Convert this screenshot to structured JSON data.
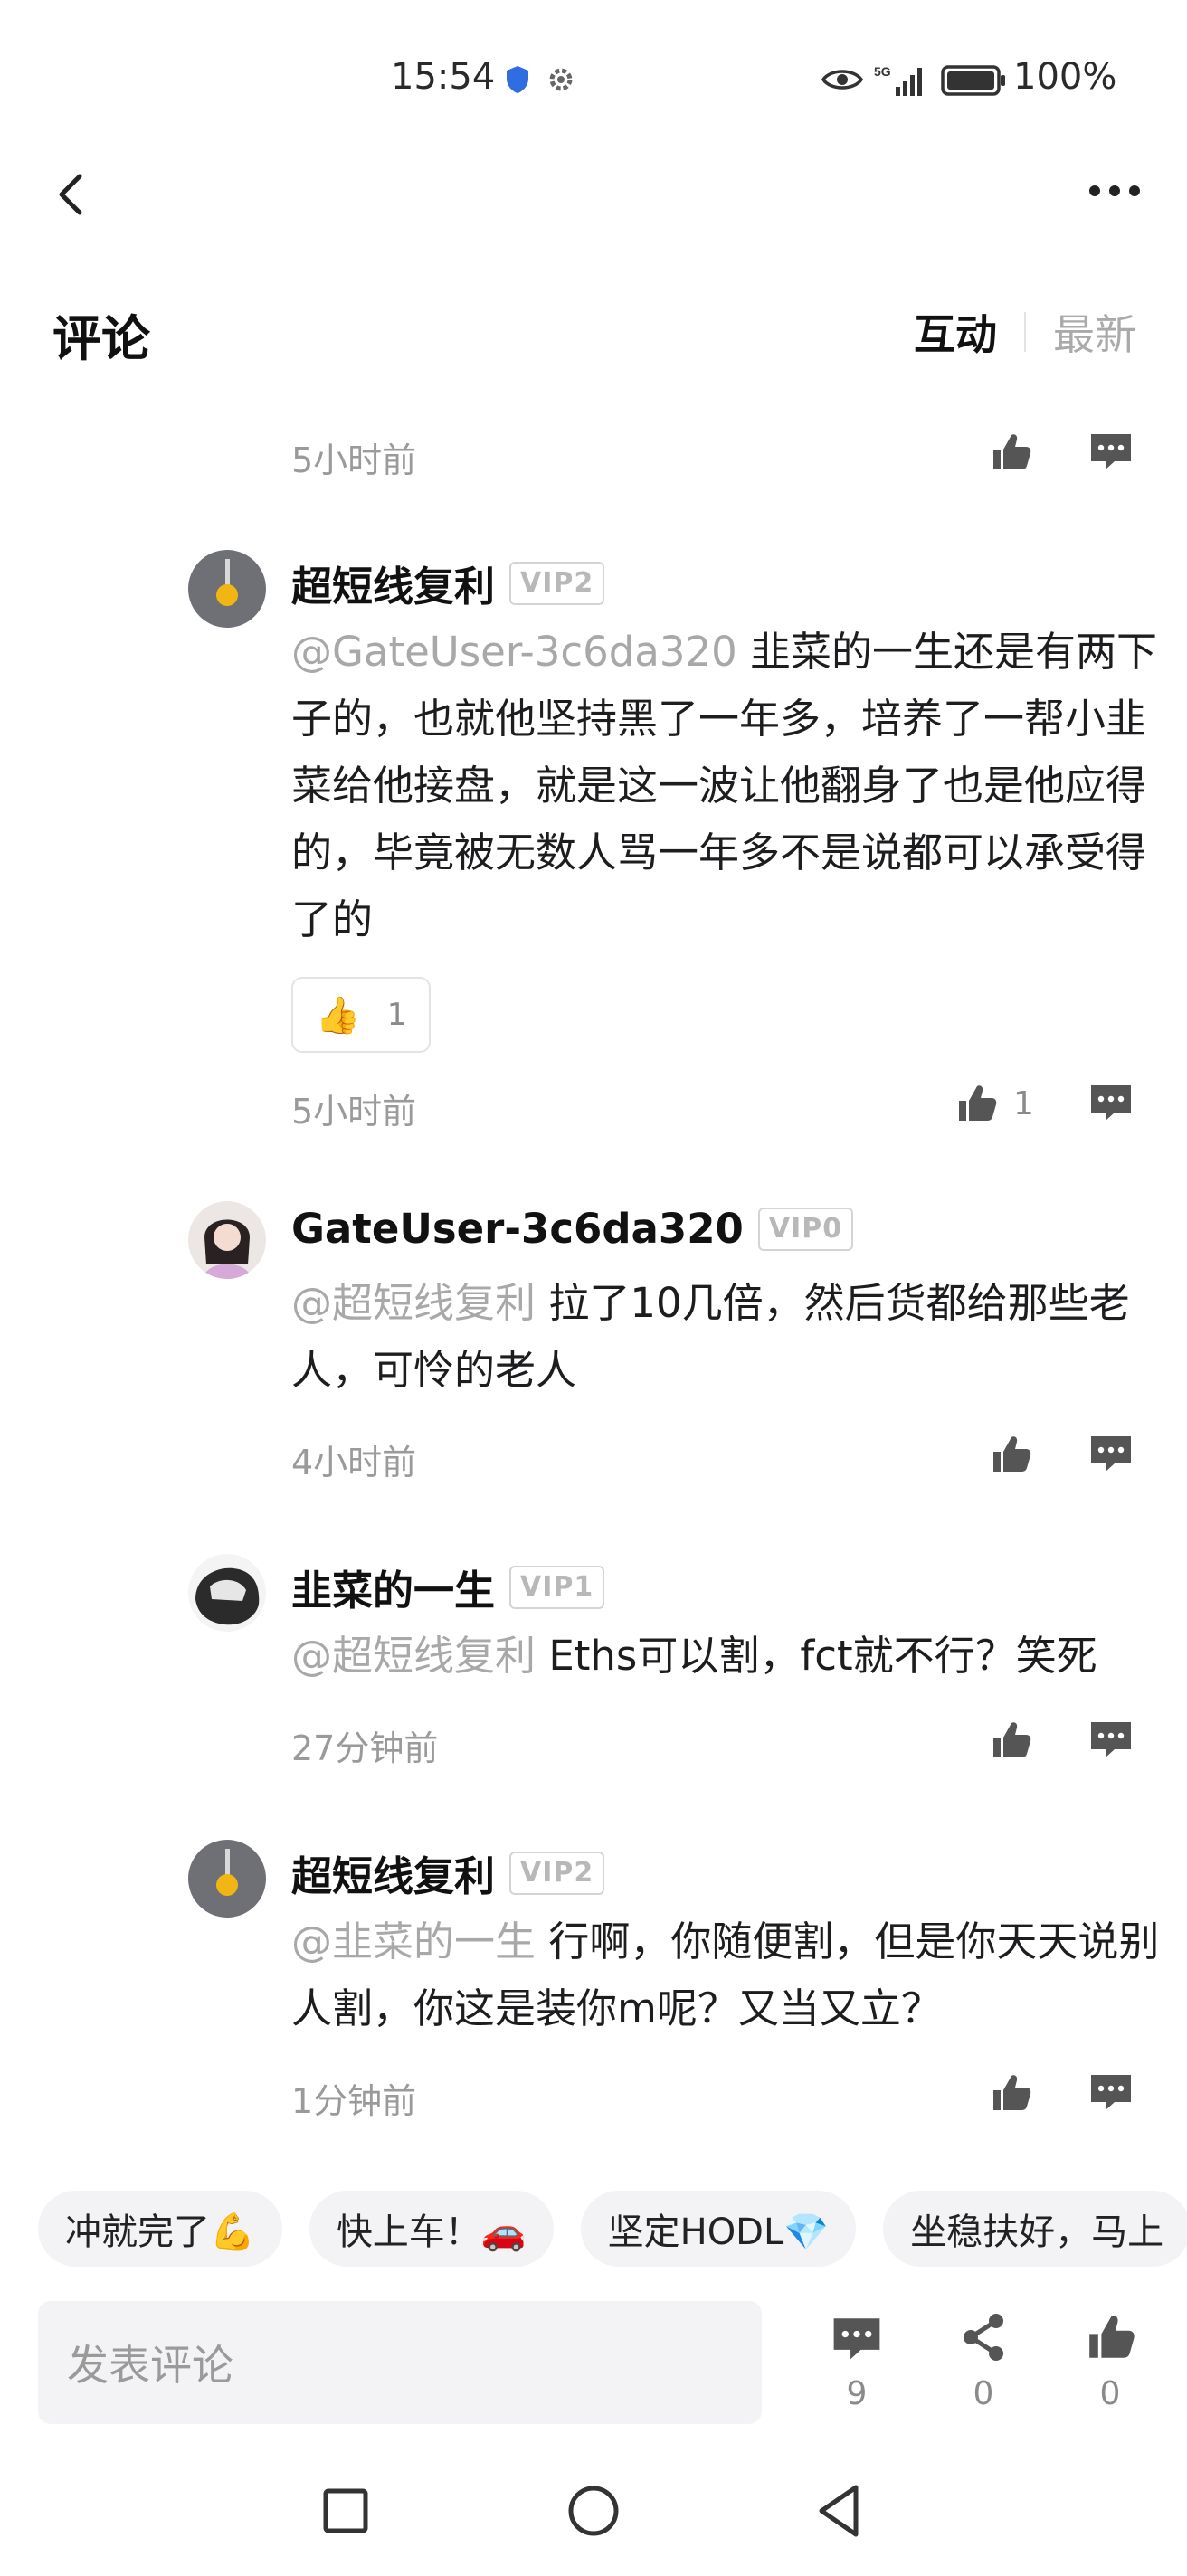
{
  "status_bar": {
    "time": "15:54",
    "network": "5G",
    "battery": "100%"
  },
  "header": {
    "title": "评论",
    "tabs": [
      {
        "label": "互动",
        "active": true
      },
      {
        "label": "最新",
        "active": false
      }
    ]
  },
  "top_partial": {
    "time": "5小时前"
  },
  "comments": [
    {
      "username": "超短线复利",
      "vip": "VIP2",
      "mention": "@GateUser-3c6da320",
      "text": " 韭菜的一生还是有两下子的，也就他坚持黑了一年多，培养了一帮小韭菜给他接盘，就是这一波让他翻身了也是他应得的，毕竟被无数人骂一年多不是说都可以承受得了的",
      "reaction": {
        "emoji": "👍",
        "count": "1"
      },
      "time": "5小时前",
      "likes": "1"
    },
    {
      "username": "GateUser-3c6da320",
      "vip": "VIP0",
      "mention": "@超短线复利",
      "text": " 拉了10几倍，然后货都给那些老人，可怜的老人",
      "time": "4小时前",
      "likes": ""
    },
    {
      "username": "韭菜的一生",
      "vip": "VIP1",
      "mention": "@超短线复利",
      "text": " Eths可以割，fct就不行？笑死",
      "time": "27分钟前",
      "likes": ""
    },
    {
      "username": "超短线复利",
      "vip": "VIP2",
      "mention": "@韭菜的一生",
      "text": " 行啊，你随便割，但是你天天说别人割，你这是装你m呢？又当又立？",
      "time": "1分钟前",
      "likes": ""
    }
  ],
  "quick_replies": [
    "冲就完了💪",
    "快上车！🚗",
    "坚定HODL💎",
    "坐稳扶好，马上"
  ],
  "input": {
    "placeholder": "发表评论"
  },
  "bottom_actions": {
    "comments": "9",
    "shares": "0",
    "likes": "0"
  },
  "colors": {
    "muted": "#9a9a9a",
    "mention": "#a8a8a8",
    "icon": "#555555"
  }
}
